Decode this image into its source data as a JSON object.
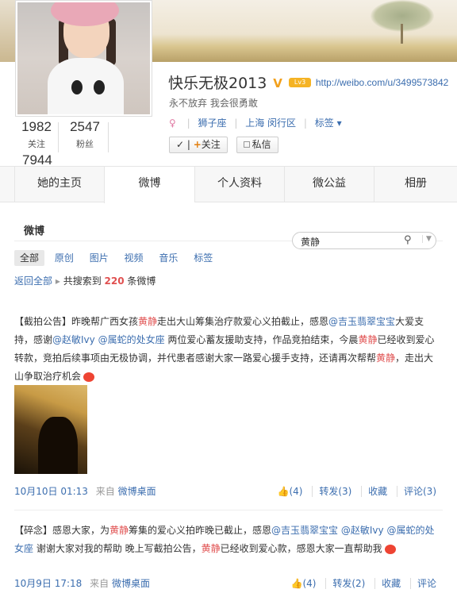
{
  "profile": {
    "name": "快乐无极2013",
    "v_badge": "V",
    "level_badge": "Lv3",
    "url": "http://weibo.com/u/3499573842",
    "motto": "永不放弃 我会很勇敢",
    "zodiac": "狮子座",
    "location": "上海 闵行区",
    "tags_label": "标签",
    "tags_arrow": "▾",
    "follow_label": "关注",
    "follow_check": "✓",
    "follow_plus": "+",
    "message_label": "私信",
    "stats": {
      "following": "1982",
      "following_label": "关注",
      "fans": "2547",
      "fans_label": "粉丝",
      "weibo": "7944"
    }
  },
  "tabs": [
    "她的主页",
    "微博",
    "个人资料",
    "微公益",
    "相册"
  ],
  "section_title": "微博",
  "search": {
    "value": "黄静",
    "icon": "search-icon",
    "dropdown": "▼"
  },
  "filters": [
    "全部",
    "原创",
    "图片",
    "视频",
    "音乐",
    "标签"
  ],
  "result": {
    "back": "返回全部",
    "prefix": "共搜索到",
    "count": "220",
    "suffix": "条微博"
  },
  "posts": [
    {
      "segments": [
        {
          "t": "【截拍公告】昨晚帮广西女孩",
          "c": "txt"
        },
        {
          "t": "黄静",
          "c": "hl"
        },
        {
          "t": "走出大山筹集治疗款爱心义拍截止，感恩",
          "c": "txt"
        },
        {
          "t": "@吉玉翡翠宝宝",
          "c": "link"
        },
        {
          "t": "大爱支持，感谢",
          "c": "txt"
        },
        {
          "t": "@赵敏Ivy",
          "c": "link"
        },
        {
          "t": " ",
          "c": "txt"
        },
        {
          "t": "@属蛇的处女座",
          "c": "link"
        },
        {
          "t": " 两位爱心蓄友援助支持，作品竞拍结束，今晨",
          "c": "txt"
        },
        {
          "t": "黄静",
          "c": "hl"
        },
        {
          "t": "已经收到爱心转款，竞拍后续事项由无极协调，并代患者感谢大家一路爱心援手支持，还请再次帮帮",
          "c": "txt"
        },
        {
          "t": "黄静",
          "c": "hl"
        },
        {
          "t": "，走出大山争取治疗机会",
          "c": "txt"
        }
      ],
      "time": "10月10日 01:13",
      "source_prefix": "来自",
      "source": "微博桌面",
      "like": "👍(4)",
      "repost": "转发(3)",
      "favorite": "收藏",
      "comment": "评论(3)"
    },
    {
      "segments": [
        {
          "t": "【碎念】感恩大家，为",
          "c": "txt"
        },
        {
          "t": "黄静",
          "c": "hl"
        },
        {
          "t": "筹集的爱心义拍昨晚已截止，感恩",
          "c": "txt"
        },
        {
          "t": "@吉玉翡翠宝宝",
          "c": "link"
        },
        {
          "t": " ",
          "c": "txt"
        },
        {
          "t": "@赵敏Ivy",
          "c": "link"
        },
        {
          "t": " ",
          "c": "txt"
        },
        {
          "t": "@属蛇的处女座",
          "c": "link"
        },
        {
          "t": " 谢谢大家对我的帮助 晚上写截拍公告，",
          "c": "txt"
        },
        {
          "t": "黄静",
          "c": "hl"
        },
        {
          "t": "已经收到爱心款，感恩大家一直帮助我",
          "c": "txt"
        }
      ],
      "time": "10月9日 17:18",
      "source_prefix": "来自",
      "source": "微博桌面",
      "like": "👍(4)",
      "repost": "转发(2)",
      "favorite": "收藏",
      "comment": "评论"
    }
  ]
}
